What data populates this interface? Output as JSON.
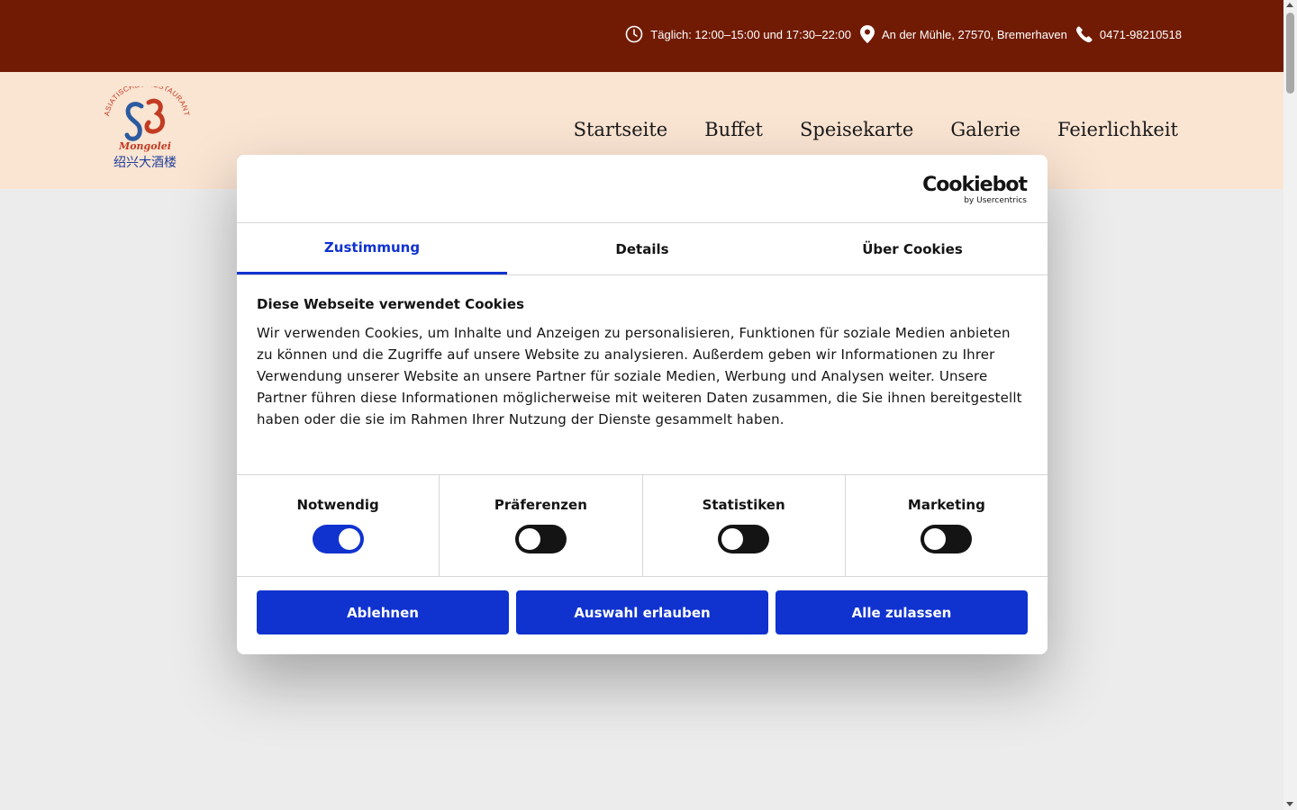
{
  "topbar": {
    "hours": "Täglich: 12:00–15:00 und 17:30–22:00",
    "address": "An der Mühle, 27570, Bremerhaven",
    "phone": "0471-98210518",
    "icons": [
      "clock-icon",
      "location-pin-icon",
      "phone-icon"
    ]
  },
  "logo": {
    "arc_text": "ASIATISCHES RESTAURANT",
    "name": "Mongolei",
    "chinese": "绍兴大酒楼"
  },
  "nav": {
    "items": [
      "Startseite",
      "Buffet",
      "Speisekarte",
      "Galerie",
      "Feierlichkeit"
    ]
  },
  "cookie_dialog": {
    "brand": "Cookiebot",
    "brand_sub": "by Usercentrics",
    "tabs": [
      "Zustimmung",
      "Details",
      "Über Cookies"
    ],
    "active_tab": "Zustimmung",
    "title": "Diese Webseite verwendet Cookies",
    "text": "Wir verwenden Cookies, um Inhalte und Anzeigen zu personalisieren, Funktionen für soziale Medien anbieten zu können und die Zugriffe auf unsere Website zu analysieren. Außerdem geben wir Informationen zu Ihrer Verwendung unserer Website an unsere Partner für soziale Medien, Werbung und Analysen weiter. Unsere Partner führen diese Informationen möglicherweise mit weiteren Daten zusammen, die Sie ihnen bereitgestellt haben oder die sie im Rahmen Ihrer Nutzung der Dienste gesammelt haben.",
    "toggles": [
      {
        "label": "Notwendig",
        "on": true
      },
      {
        "label": "Präferenzen",
        "on": false
      },
      {
        "label": "Statistiken",
        "on": false
      },
      {
        "label": "Marketing",
        "on": false
      }
    ],
    "buttons": {
      "decline": "Ablehnen",
      "allow_selection": "Auswahl erlauben",
      "allow_all": "Alle zulassen"
    }
  },
  "colors": {
    "topbar_bg": "#721b04",
    "header_bg": "#fae4d2",
    "accent_blue": "#1032cf"
  }
}
